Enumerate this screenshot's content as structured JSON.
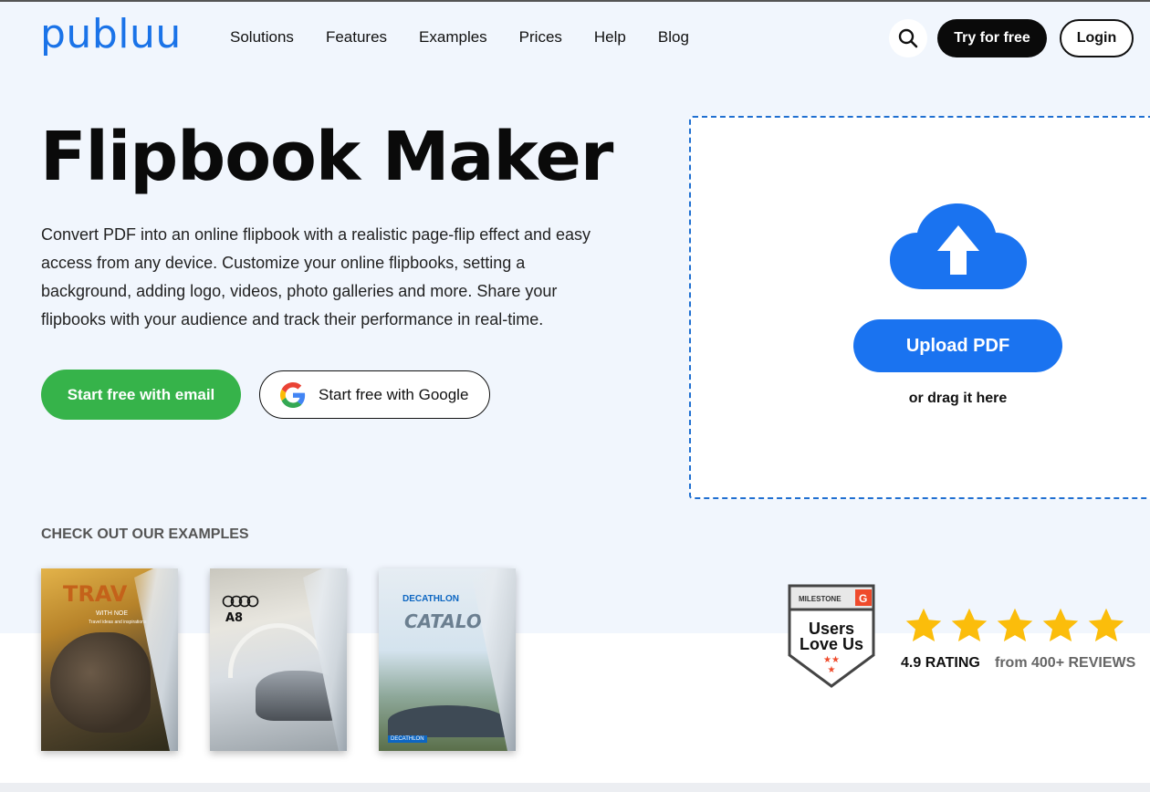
{
  "header": {
    "logo": "publuu",
    "nav": [
      "Solutions",
      "Features",
      "Examples",
      "Prices",
      "Help",
      "Blog"
    ],
    "try_label": "Try for free",
    "login_label": "Login"
  },
  "hero": {
    "title": "Flipbook Maker",
    "description": "Convert PDF into an online flipbook with a realistic page-flip effect and easy access from any device. Customize your online flipbooks, setting a background, adding logo, videos, photo galleries and more. Share your flipbooks with your audience and track their performance in real-time.",
    "email_button": "Start free with email",
    "google_button": "Start free with Google"
  },
  "upload": {
    "button_label": "Upload PDF",
    "drag_text": "or drag it here"
  },
  "examples": {
    "label": "CHECK OUT OUR EXAMPLES",
    "items": [
      {
        "title": "TRAV",
        "sub": "WITH NOE",
        "tiny": "Travel ideas and inspirations"
      },
      {
        "title": "A8"
      },
      {
        "brand": "DECATHLON",
        "title": "CATALO",
        "brand_bottom": "DECATHLON"
      }
    ]
  },
  "rating": {
    "badge_top": "MILESTONE",
    "badge_line1": "Users",
    "badge_line2": "Love Us",
    "stars": 5,
    "rating_text": "4.9 RATING",
    "reviews_text": "from 400+ REVIEWS"
  },
  "colors": {
    "brand_blue": "#1a73e8",
    "green": "#36b34a",
    "star": "#fbbd0b",
    "hero_bg": "#f1f6fd"
  },
  "icons": [
    "search-icon",
    "google-icon",
    "cloud-upload-icon",
    "star-icon",
    "g2-badge-icon"
  ]
}
